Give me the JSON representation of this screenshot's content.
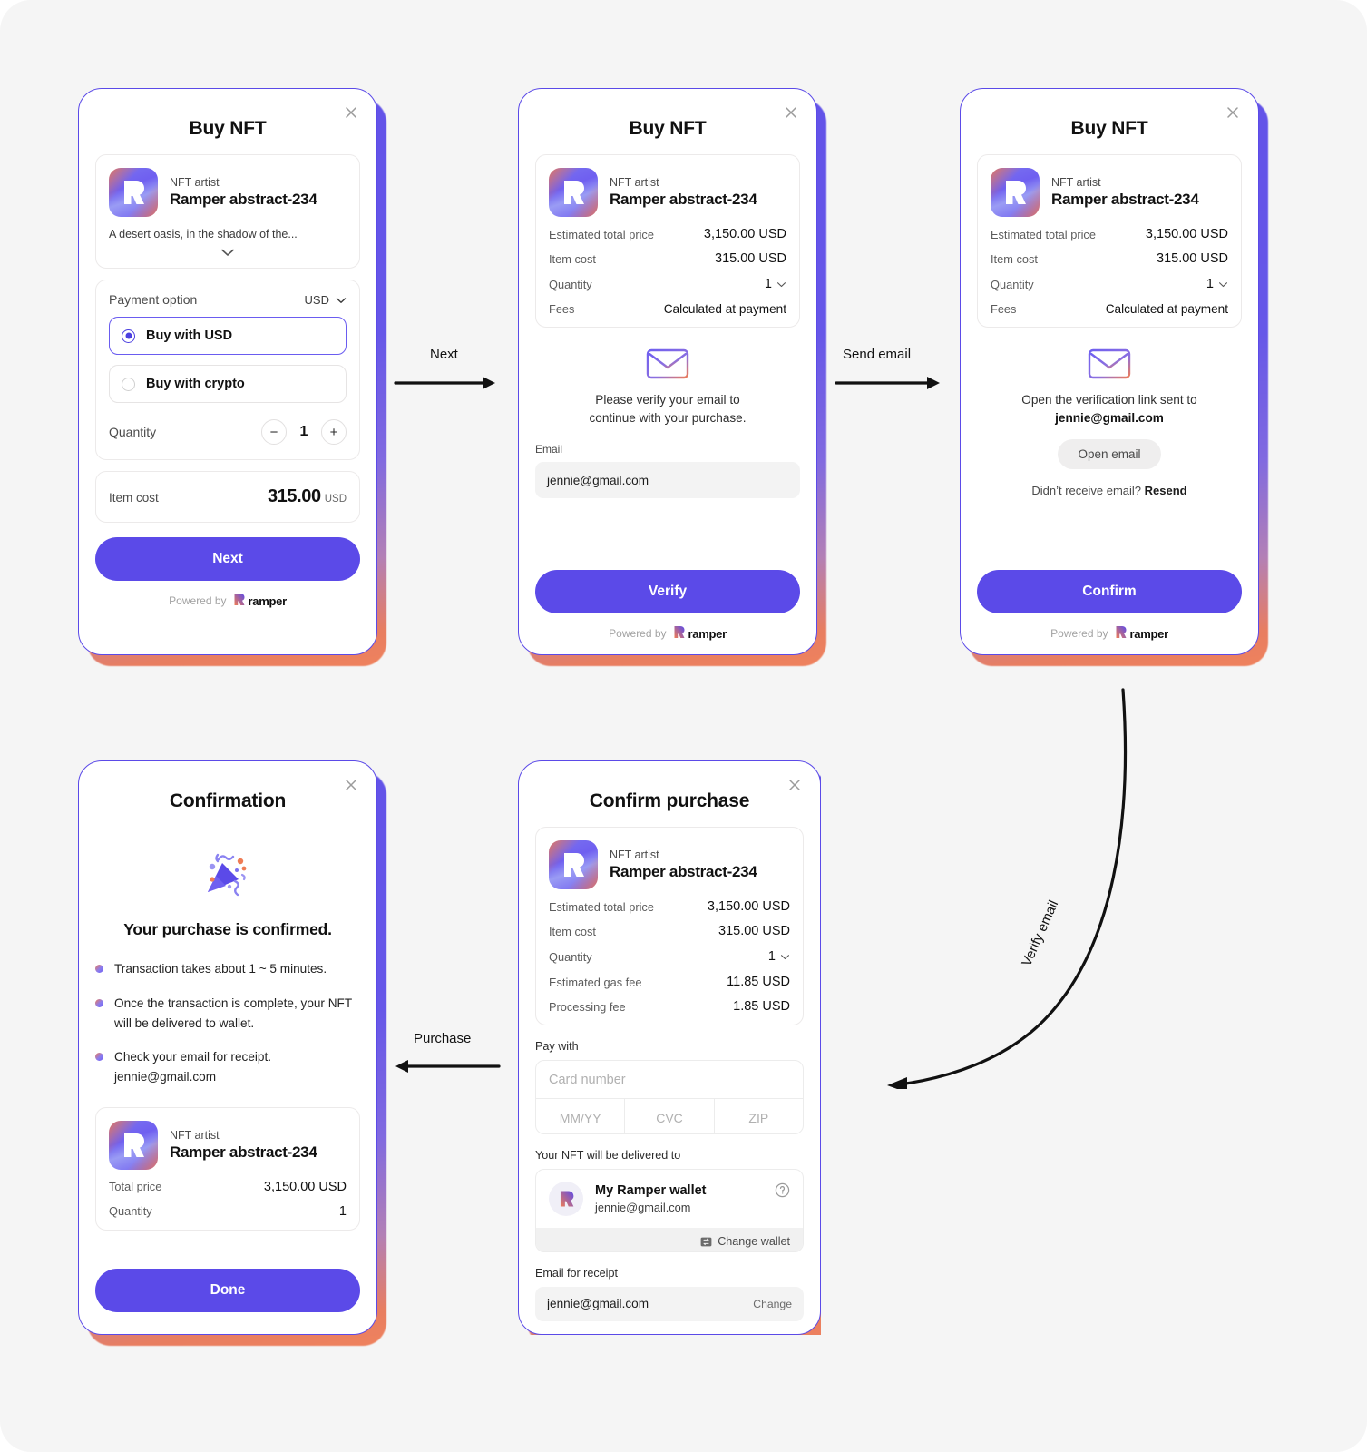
{
  "nft": {
    "artist_label": "NFT artist",
    "name": "Ramper abstract-234",
    "description": "A desert oasis, in the shadow of the..."
  },
  "brand": {
    "powered_by": "Powered by",
    "name": "ramper",
    "accent": "#5b4ae8"
  },
  "card1": {
    "title": "Buy NFT",
    "payment_option_label": "Payment option",
    "currency": "USD",
    "option_usd": "Buy with USD",
    "option_crypto": "Buy with crypto",
    "quantity_label": "Quantity",
    "quantity_value": "1",
    "minus": "−",
    "plus": "+",
    "item_cost_label": "Item cost",
    "item_cost_value": "315.00",
    "item_cost_currency": "USD",
    "cta": "Next"
  },
  "card2": {
    "title": "Buy NFT",
    "rows": [
      {
        "k": "Estimated total price",
        "v": "3,150.00 USD"
      },
      {
        "k": "Item cost",
        "v": "315.00 USD"
      },
      {
        "k": "Quantity",
        "v": "1"
      },
      {
        "k": "Fees",
        "v": "Calculated at payment"
      }
    ],
    "verify_line1": "Please verify your email to",
    "verify_line2": "continue with your purchase.",
    "email_label": "Email",
    "email_value": "jennie@gmail.com",
    "cta": "Verify"
  },
  "card3": {
    "title": "Buy NFT",
    "rows": [
      {
        "k": "Estimated total price",
        "v": "3,150.00 USD"
      },
      {
        "k": "Item cost",
        "v": "315.00 USD"
      },
      {
        "k": "Quantity",
        "v": "1"
      },
      {
        "k": "Fees",
        "v": "Calculated at payment"
      }
    ],
    "open_line": "Open the verification link sent to",
    "email_value": "jennie@gmail.com",
    "open_email_btn": "Open email",
    "resend_prefix": "Didn’t receive email?",
    "resend_link": "Resend",
    "cta": "Confirm"
  },
  "card4": {
    "title": "Confirmation",
    "headline": "Your purchase is confirmed.",
    "bullets": [
      "Transaction takes about 1 ~ 5 minutes.",
      "Once the transaction is complete, your NFT will be delivered to wallet.",
      "Check your email for receipt."
    ],
    "receipt_email": "jennie@gmail.com",
    "summary": [
      {
        "k": "Total price",
        "v": "3,150.00 USD"
      },
      {
        "k": "Quantity",
        "v": "1"
      }
    ],
    "cta": "Done"
  },
  "card5": {
    "title": "Confirm purchase",
    "rows": [
      {
        "k": "Estimated total price",
        "v": "3,150.00 USD"
      },
      {
        "k": "Item cost",
        "v": "315.00 USD"
      },
      {
        "k": "Quantity",
        "v": "1"
      },
      {
        "k": "Estimated gas fee",
        "v": "11.85 USD"
      },
      {
        "k": "Processing fee",
        "v": "1.85 USD"
      }
    ],
    "pay_with_label": "Pay with",
    "card_number_placeholder": "Card number",
    "expiry_placeholder": "MM/YY",
    "cvc_placeholder": "CVC",
    "zip_placeholder": "ZIP",
    "delivered_label": "Your NFT will be delivered to",
    "wallet_name": "My Ramper wallet",
    "wallet_email": "jennie@gmail.com",
    "change_wallet": "Change wallet",
    "email_receipt_label": "Email for receipt",
    "receipt_email": "jennie@gmail.com",
    "receipt_change": "Change"
  },
  "arrows": {
    "next": "Next",
    "send_email": "Send email",
    "verify_email": "Verify email",
    "purchase": "Purchase"
  }
}
